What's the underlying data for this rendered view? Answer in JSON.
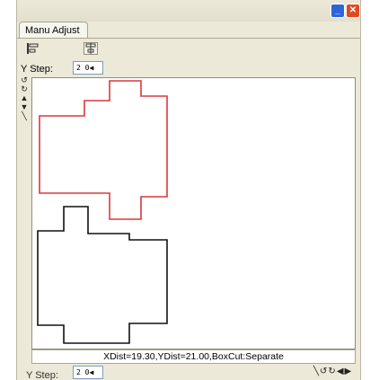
{
  "window": {
    "minimize_icon": "minimize-icon",
    "close_icon": "close-icon"
  },
  "panel": {
    "tab_label": "Manu Adjust",
    "tool_icons": [
      "align-left-icon",
      "align-center-icon"
    ]
  },
  "y_step": {
    "label": "Y Step:",
    "value": "2 0◀"
  },
  "side_tools": [
    "rotate-ccw-icon",
    "rotate-cw-icon",
    "arrow-up-icon",
    "arrow-down-icon",
    "line-tool-icon"
  ],
  "canvas": {
    "selected_color": "#d9383a",
    "outline_color": "#111111"
  },
  "status": {
    "text": "XDist=19.30,YDist=21.00,BoxCut:Separate"
  },
  "bottom_bar": {
    "label": "Y Step:",
    "value": "2 0◀",
    "tools": [
      "line-tool-icon",
      "rotate-ccw-icon",
      "rotate-cw-icon",
      "arrow-left-icon",
      "arrow-right-icon"
    ]
  }
}
